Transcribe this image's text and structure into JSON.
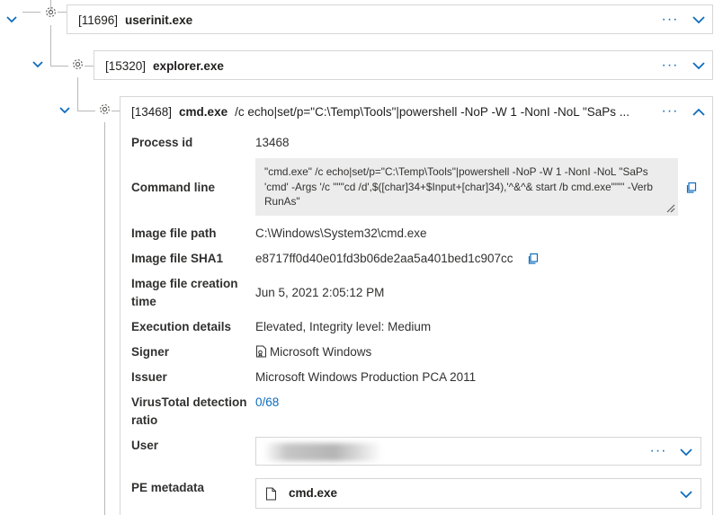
{
  "tree": {
    "nodes": [
      {
        "pid": "[11696]",
        "name": "userinit.exe",
        "cmd": "",
        "more_label": "···",
        "expanded": false
      },
      {
        "pid": "[15320]",
        "name": "explorer.exe",
        "cmd": "",
        "more_label": "···",
        "expanded": false
      },
      {
        "pid": "[13468]",
        "name": "cmd.exe",
        "cmd": "/c echo|set/p=\"C:\\Temp\\Tools\"|powershell -NoP -W 1 -NonI -NoL \"SaPs ...",
        "more_label": "···",
        "expanded": true
      }
    ]
  },
  "details": {
    "process_id": {
      "label": "Process id",
      "value": "13468"
    },
    "command_line": {
      "label": "Command line",
      "value": "\"cmd.exe\" /c echo|set/p=\"C:\\Temp\\Tools\"|powershell -NoP -W 1 -NonI -NoL \"SaPs 'cmd' -Args '/c \"\"\"cd /d',$([char]34+$Input+[char]34),'^&^& start /b cmd.exe\"\"\"' -Verb RunAs\""
    },
    "image_file_path": {
      "label": "Image file path",
      "value": "C:\\Windows\\System32\\cmd.exe"
    },
    "image_file_sha1": {
      "label": "Image file SHA1",
      "value": "e8717ff0d40e01fd3b06de2aa5a401bed1c907cc"
    },
    "image_file_creation_time": {
      "label": "Image file creation time",
      "value": "Jun 5, 2021 2:05:12 PM"
    },
    "execution_details": {
      "label": "Execution details",
      "value": "Elevated, Integrity level: Medium"
    },
    "signer": {
      "label": "Signer",
      "value": "Microsoft Windows"
    },
    "issuer": {
      "label": "Issuer",
      "value": "Microsoft Windows Production PCA 2011"
    },
    "virustotal": {
      "label": "VirusTotal detection ratio",
      "value": "0/68"
    },
    "user": {
      "label": "User",
      "more_label": "···"
    },
    "pe_metadata": {
      "label": "PE metadata",
      "value": "cmd.exe"
    }
  },
  "colors": {
    "accent": "#0f6cbd",
    "border": "#d6d6d6",
    "cmd_bg": "#ececec"
  }
}
